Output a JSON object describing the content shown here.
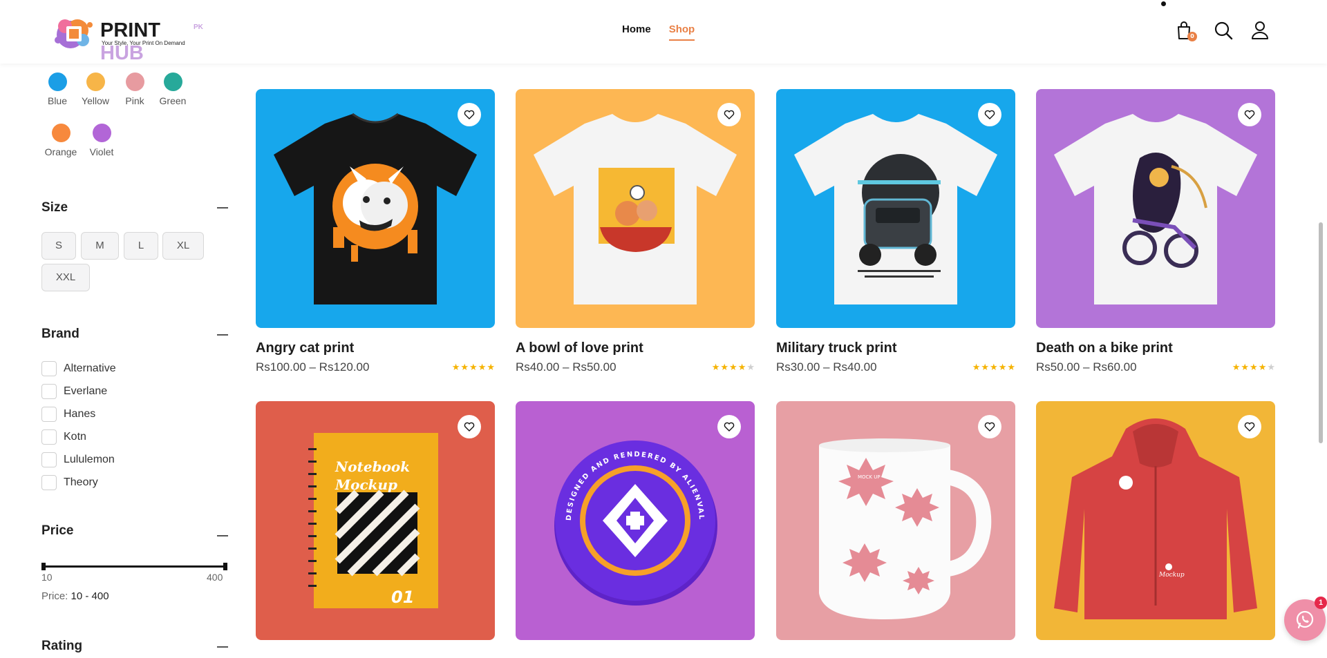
{
  "header": {
    "logo": {
      "brand_primary": "PRINT",
      "brand_accent": "HUB",
      "sup": "PK",
      "tagline": "Your Style, Your Print On Demand"
    },
    "nav": [
      {
        "label": "Home",
        "active": false
      },
      {
        "label": "Shop",
        "active": true
      }
    ],
    "cart_count": "0",
    "icons": [
      "bag-icon",
      "search-icon",
      "user-icon"
    ]
  },
  "filters": {
    "colors": [
      {
        "label": "Blue",
        "hex": "#1b9ee6"
      },
      {
        "label": "Yellow",
        "hex": "#f7b548"
      },
      {
        "label": "Pink",
        "hex": "#e79ba0"
      },
      {
        "label": "Green",
        "hex": "#27a99a"
      },
      {
        "label": "Orange",
        "hex": "#f7893d"
      },
      {
        "label": "Violet",
        "hex": "#b266d7"
      }
    ],
    "size": {
      "title": "Size",
      "options": [
        "S",
        "M",
        "L",
        "XL",
        "XXL"
      ]
    },
    "brand": {
      "title": "Brand",
      "options": [
        "Alternative",
        "Everlane",
        "Hanes",
        "Kotn",
        "Lululemon",
        "Theory"
      ]
    },
    "price": {
      "title": "Price",
      "min": "10",
      "max": "400",
      "label": "Price:",
      "range_text": "10 - 400"
    },
    "rating": {
      "title": "Rating"
    }
  },
  "products": [
    {
      "title": "Angry cat print",
      "price": "Rs100.00 – Rs120.00",
      "rating": 5,
      "bg": "#17a7ec"
    },
    {
      "title": "A bowl of love print",
      "price": "Rs40.00 – Rs50.00",
      "rating": 4,
      "bg": "#fdb753"
    },
    {
      "title": "Military truck print",
      "price": "Rs30.00 – Rs40.00",
      "rating": 5,
      "bg": "#17a7ec"
    },
    {
      "title": "Death on a bike print",
      "price": "Rs50.00 – Rs60.00",
      "rating": 4,
      "bg": "#b374d8"
    },
    {
      "title": "",
      "price": "",
      "rating": 0,
      "bg": "#df5e4b"
    },
    {
      "title": "",
      "price": "",
      "rating": 0,
      "bg": "#b960d2"
    },
    {
      "title": "",
      "price": "",
      "rating": 0,
      "bg": "#e79fa4"
    },
    {
      "title": "",
      "price": "",
      "rating": 0,
      "bg": "#f2b637"
    }
  ],
  "mockups": {
    "notebook_line1": "Notebook",
    "notebook_line2": "Mockup",
    "notebook_num": "01",
    "badge_text": "DESIGNED AND RENDERED BY ALIENVALLEY",
    "mug_text": "MOCK UP",
    "hoodie_text": "Mockup"
  },
  "chat": {
    "badge": "1"
  },
  "colors": {
    "accent": "#e98045",
    "star": "#f5b301",
    "star_empty": "#cfcfcf"
  }
}
